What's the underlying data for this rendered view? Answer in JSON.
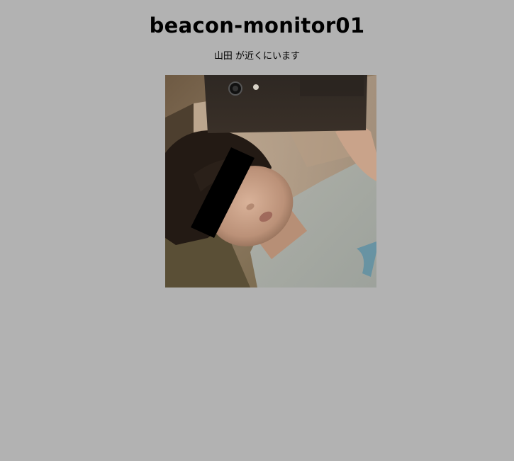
{
  "page": {
    "title": "beacon-monitor01",
    "message": "山田 が近くにいます"
  },
  "photo": {
    "subject": "photo of a person taking a mirror selfie with a phone, eyes covered by a black bar"
  },
  "colors": {
    "background": "#b2b2b2",
    "text": "#000000"
  }
}
